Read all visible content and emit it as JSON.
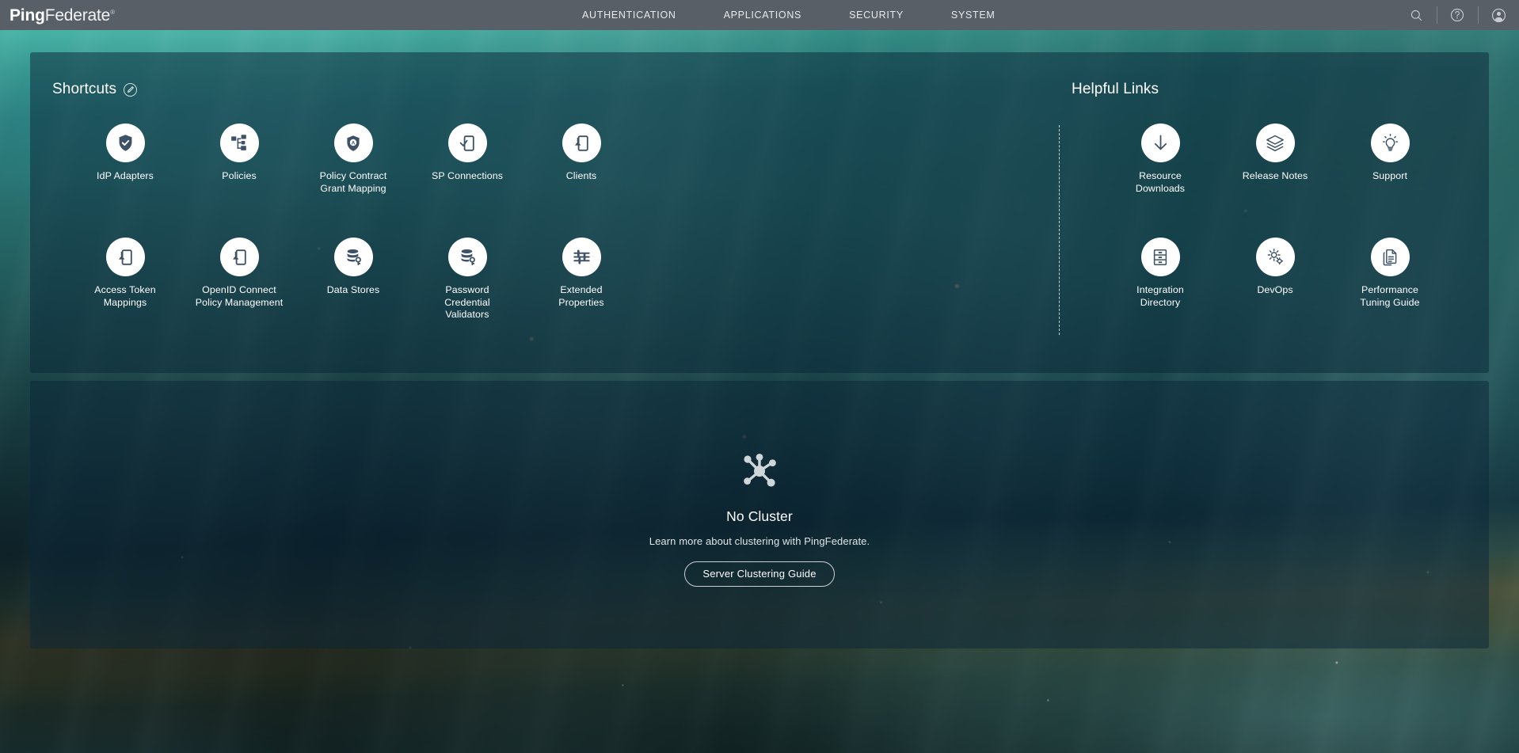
{
  "header": {
    "brand_ping": "Ping",
    "brand_federate": "Federate",
    "brand_reg": "®",
    "nav": [
      {
        "label": "AUTHENTICATION",
        "name": "nav-authentication"
      },
      {
        "label": "APPLICATIONS",
        "name": "nav-applications"
      },
      {
        "label": "SECURITY",
        "name": "nav-security"
      },
      {
        "label": "SYSTEM",
        "name": "nav-system"
      }
    ],
    "actions": [
      {
        "icon": "search-icon",
        "label": "Search"
      },
      {
        "icon": "help-icon",
        "label": "Help"
      },
      {
        "icon": "user-avatar-icon",
        "label": "Account"
      }
    ]
  },
  "shortcuts": {
    "title": "Shortcuts",
    "edit_icon": "pencil-edit-icon",
    "items": [
      {
        "label": "IdP Adapters",
        "icon": "shield-check-icon"
      },
      {
        "label": "Policies",
        "icon": "policy-tree-icon"
      },
      {
        "label": "Policy Contract\nGrant Mapping",
        "icon": "shield-badge-icon"
      },
      {
        "label": "SP Connections",
        "icon": "device-check-icon"
      },
      {
        "label": "Clients",
        "icon": "device-key-icon"
      },
      {
        "label": "Access Token\nMappings",
        "icon": "device-token-icon"
      },
      {
        "label": "OpenID Connect\nPolicy Management",
        "icon": "device-token-icon"
      },
      {
        "label": "Data Stores",
        "icon": "database-key-icon"
      },
      {
        "label": "Password\nCredential\nValidators",
        "icon": "database-key-icon"
      },
      {
        "label": "Extended\nProperties",
        "icon": "sliders-icon"
      }
    ]
  },
  "helpful_links": {
    "title": "Helpful Links",
    "items": [
      {
        "label": "Resource\nDownloads",
        "icon": "download-arrow-icon"
      },
      {
        "label": "Release Notes",
        "icon": "layers-icon"
      },
      {
        "label": "Support",
        "icon": "lightbulb-icon"
      },
      {
        "label": "Integration\nDirectory",
        "icon": "file-cabinet-icon"
      },
      {
        "label": "DevOps",
        "icon": "gears-icon"
      },
      {
        "label": "Performance\nTuning Guide",
        "icon": "documents-icon"
      }
    ]
  },
  "cluster": {
    "icon": "cluster-hub-icon",
    "title": "No Cluster",
    "subtitle": "Learn more about clustering with PingFederate.",
    "button_label": "Server Clustering Guide"
  },
  "colors": {
    "header_bg": "#585f67",
    "panel_bg": "rgba(10,38,55,0.50)",
    "icon_navy": "#3d5266",
    "text_white": "#ffffff",
    "background_teal": "#1c6f72"
  }
}
